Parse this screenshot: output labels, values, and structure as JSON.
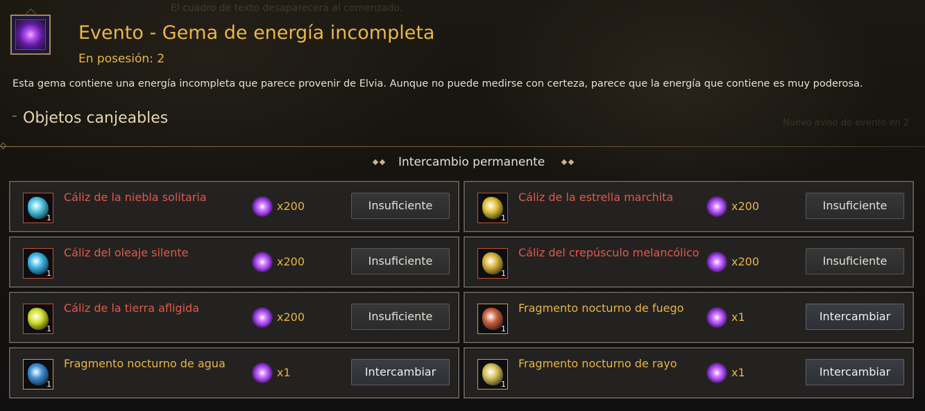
{
  "background": {
    "faded_text_top": "El cuadro de texto desaparecerá al comenzado.",
    "faded_text_right": "Nuevo aviso de evento en 2"
  },
  "header": {
    "icon": "purple-energy-gem-icon",
    "title": "Evento - Gema de energía incompleta",
    "owned": "En posesión: 2",
    "description": "Esta gema contiene una energía incompleta que parece provenir de Elvia. Aunque no puede medirse con certeza, parece que la energía que contiene es muy poderosa."
  },
  "section": {
    "title": "Objetos canjeables",
    "subsection": "Intercambio permanente"
  },
  "colors": {
    "accent_gold": "#e9b64a",
    "name_red": "#e0594a"
  },
  "items": [
    {
      "name": "Cáliz de la niebla solitaria",
      "name_color": "red",
      "icon": "blue-crystal-icon",
      "icon_color": "#4fc6e0",
      "qty": "1",
      "cost": "x200",
      "button": "Insuficiente",
      "enabled": false
    },
    {
      "name": "Cáliz de la estrella marchita",
      "name_color": "red",
      "icon": "yellow-crystal-icon",
      "icon_color": "#e0c23a",
      "qty": "1",
      "cost": "x200",
      "button": "Insuficiente",
      "enabled": false
    },
    {
      "name": "Cáliz del oleaje silente",
      "name_color": "red",
      "icon": "blue-crystal-icon",
      "icon_color": "#3fb5e8",
      "qty": "1",
      "cost": "x200",
      "button": "Insuficiente",
      "enabled": false
    },
    {
      "name": "Cáliz del crepúsculo melancólico",
      "name_color": "red",
      "icon": "yellow-crystal-icon",
      "icon_color": "#d9b53a",
      "qty": "1",
      "cost": "x200",
      "button": "Insuficiente",
      "enabled": false
    },
    {
      "name": "Cáliz de la tierra afligida",
      "name_color": "red",
      "icon": "yellow-green-crystal-icon",
      "icon_color": "#d8e02c",
      "qty": "1",
      "cost": "x200",
      "button": "Insuficiente",
      "enabled": false
    },
    {
      "name": "Fragmento nocturno de fuego",
      "name_color": "gold",
      "icon": "fire-fragment-icon",
      "icon_color": "#c9603e",
      "qty": "1",
      "cost": "x1",
      "button": "Intercambiar",
      "enabled": true
    },
    {
      "name": "Fragmento nocturno de agua",
      "name_color": "gold",
      "icon": "water-fragment-icon",
      "icon_color": "#3d8fd4",
      "qty": "1",
      "cost": "x1",
      "button": "Intercambiar",
      "enabled": true
    },
    {
      "name": "Fragmento nocturno de rayo",
      "name_color": "gold",
      "icon": "lightning-fragment-icon",
      "icon_color": "#d8c25a",
      "qty": "1",
      "cost": "x1",
      "button": "Intercambiar",
      "enabled": true
    }
  ]
}
